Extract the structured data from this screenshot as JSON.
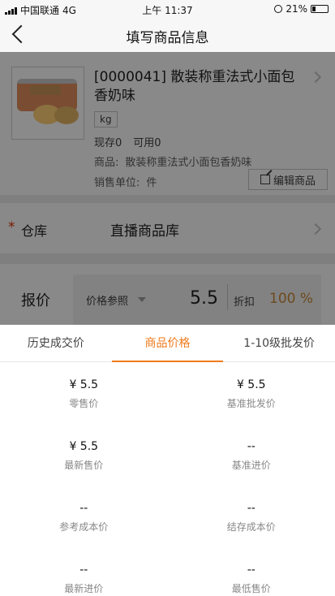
{
  "status_bar": {
    "carrier": "中国联通",
    "network": "4G",
    "time": "上午 11:37",
    "battery": "21%",
    "battery_level": 0.21
  },
  "nav": {
    "title": "填写商品信息"
  },
  "product": {
    "title": "[0000041] 散装称重法式小面包香奶味",
    "unit_tag": "kg",
    "stock_label": "现存0",
    "available_label": "可用0",
    "goods_label": "商品:",
    "goods_value": "散装称重法式小面包香奶味",
    "sale_unit_label": "销售单位:",
    "sale_unit_value": "件",
    "edit_label": "编辑商品"
  },
  "warehouse": {
    "required_mark": "*",
    "label": "仓库",
    "value": "直播商品库"
  },
  "price": {
    "label": "报价",
    "ref_label": "价格参照",
    "value": "5.5",
    "discount_label": "折扣",
    "discount_value": "100 %"
  },
  "sheet": {
    "tabs": [
      {
        "label": "历史成交价"
      },
      {
        "label": "商品价格"
      },
      {
        "label": "1-10级批发价"
      }
    ],
    "active_tab": 1,
    "items": [
      {
        "value": "¥ 5.5",
        "label": "零售价"
      },
      {
        "value": "¥ 5.5",
        "label": "基准批发价"
      },
      {
        "value": "¥ 5.5",
        "label": "最新售价"
      },
      {
        "value": "--",
        "label": "基准进价"
      },
      {
        "value": "--",
        "label": "参考成本价"
      },
      {
        "value": "--",
        "label": "结存成本价"
      },
      {
        "value": "--",
        "label": "最新进价"
      },
      {
        "value": "--",
        "label": "最低售价"
      }
    ]
  },
  "colors": {
    "accent": "#f07a1b",
    "overlay": "#898989"
  }
}
